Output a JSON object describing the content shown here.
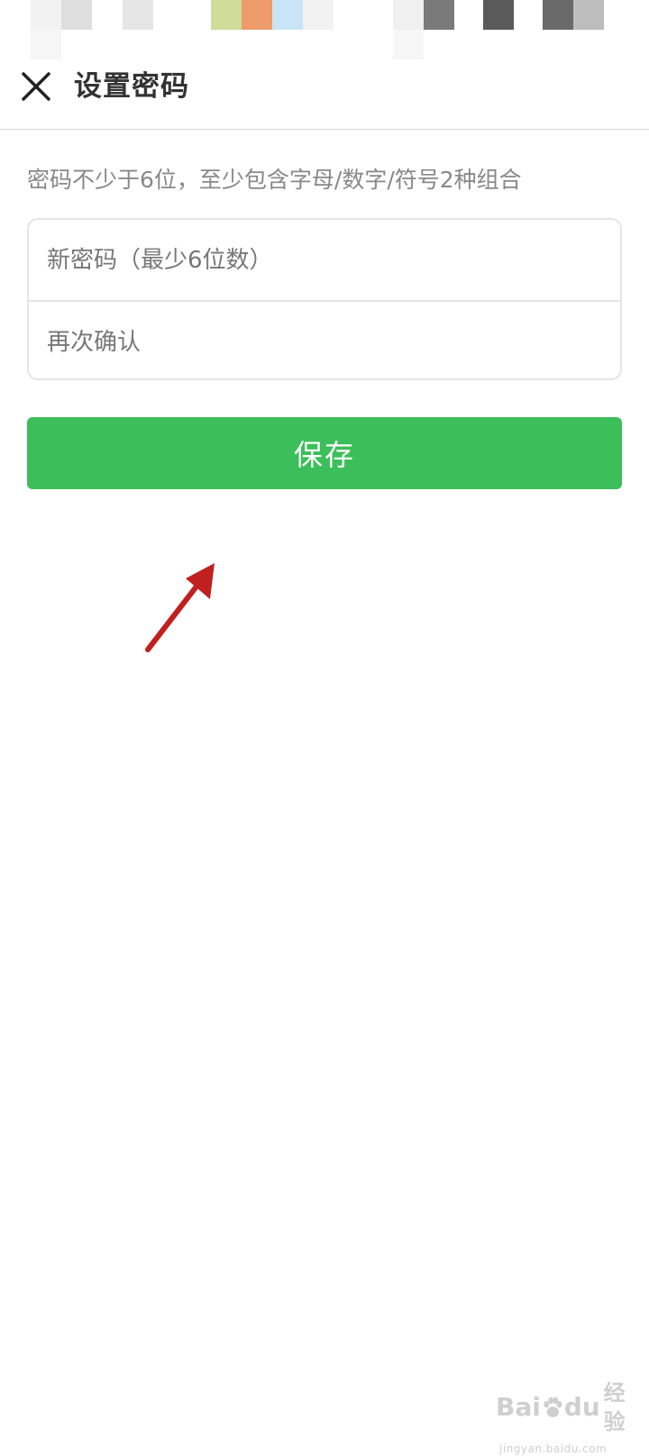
{
  "header": {
    "title": "设置密码",
    "close_icon": "close-icon"
  },
  "hint": "密码不少于6位，至少包含字母/数字/符号2种组合",
  "form": {
    "new_password_placeholder": "新密码（最少6位数）",
    "confirm_placeholder": "再次确认",
    "save_label": "保存"
  },
  "colors": {
    "accent": "#3cbf5a",
    "annotation_arrow": "#c0201f"
  },
  "watermark": {
    "logo_text": "Bai",
    "logo_text_2": "du",
    "logo_cn": "经验",
    "subtext": "jingyan.baidu.com"
  }
}
